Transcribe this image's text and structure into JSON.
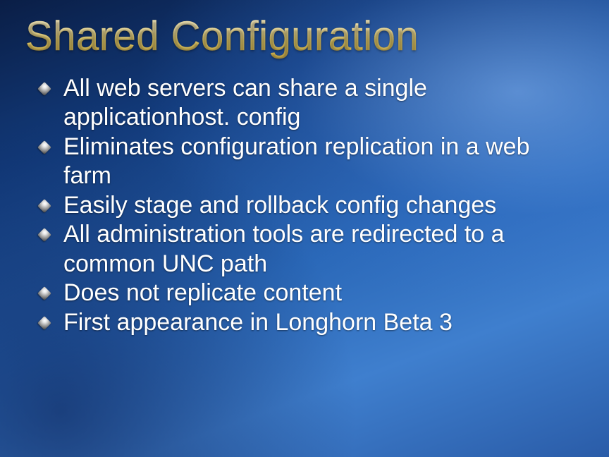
{
  "title": "Shared Configuration",
  "bullets": [
    "All web servers can share a single applicationhost. config",
    "Eliminates configuration replication in a web farm",
    "Easily stage and rollback config changes",
    "All administration tools are redirected to a common UNC path",
    "Does not replicate content",
    "First appearance in Longhorn Beta 3"
  ]
}
